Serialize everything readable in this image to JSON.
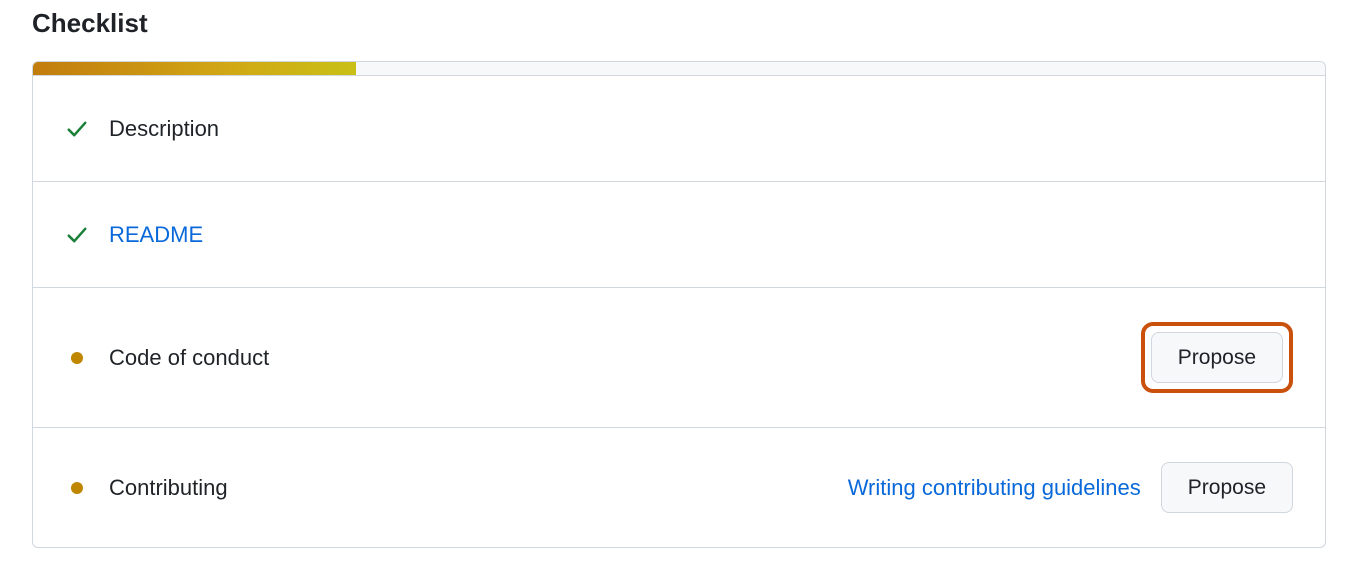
{
  "heading": "Checklist",
  "progress_percent": 25,
  "items": [
    {
      "label": "Description",
      "status": "done",
      "is_link": false,
      "help_link": null,
      "propose": null,
      "highlighted": false
    },
    {
      "label": "README",
      "status": "done",
      "is_link": true,
      "help_link": null,
      "propose": null,
      "highlighted": false
    },
    {
      "label": "Code of conduct",
      "status": "pending",
      "is_link": false,
      "help_link": null,
      "propose": "Propose",
      "highlighted": true
    },
    {
      "label": "Contributing",
      "status": "pending",
      "is_link": false,
      "help_link": "Writing contributing guidelines",
      "propose": "Propose",
      "highlighted": false
    }
  ]
}
